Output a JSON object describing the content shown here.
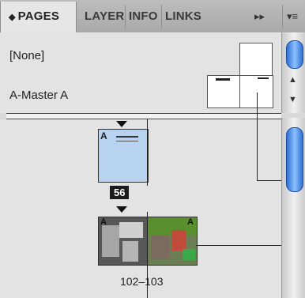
{
  "tabs": [
    {
      "label": "PAGES",
      "prefix": "◆"
    },
    {
      "label": "LAYERS"
    },
    {
      "label": "INFO"
    },
    {
      "label": "LINKS"
    }
  ],
  "tab_controls": {
    "forward": "▸▸",
    "menu": "▾≡"
  },
  "masters": [
    {
      "label": "[None]"
    },
    {
      "label": "A-Master A"
    }
  ],
  "pages": {
    "page_prefix": "A",
    "page_number": "56",
    "spread_prefix_left": "A",
    "spread_prefix_right": "A",
    "spread_label": "102–103"
  },
  "scroll_icons": {
    "up": "▲",
    "down": "▼"
  }
}
